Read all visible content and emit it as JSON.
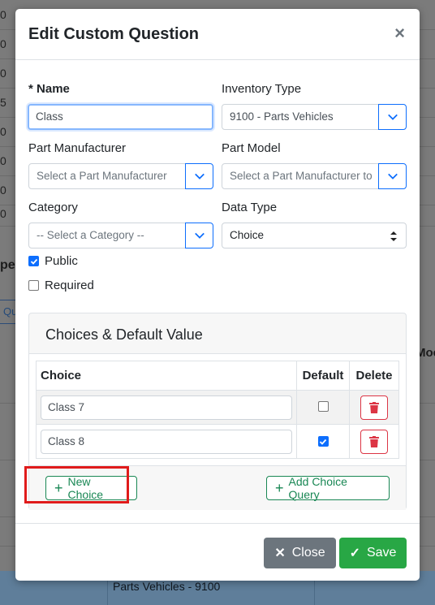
{
  "background": {
    "row_numbers": [
      "0",
      "0",
      "0",
      "5",
      "0",
      "0",
      "0",
      "0"
    ],
    "partial_heading": "pe",
    "partial_button": "Qu",
    "partial_right_heading": "Moc",
    "bottom_cell": "Parts Vehicles - 9100"
  },
  "modal": {
    "title": "Edit Custom Question",
    "close_glyph": "×",
    "fields": {
      "name": {
        "required_marker": "*",
        "label": "Name",
        "value": "Class"
      },
      "inventory_type": {
        "label": "Inventory Type",
        "value": "9100 - Parts Vehicles"
      },
      "part_manufacturer": {
        "label": "Part Manufacturer",
        "placeholder": "Select a Part Manufacturer"
      },
      "part_model": {
        "label": "Part Model",
        "placeholder": "Select a Part Manufacturer to"
      },
      "category": {
        "label": "Category",
        "placeholder": "-- Select a Category --"
      },
      "data_type": {
        "label": "Data Type",
        "value": "Choice"
      }
    },
    "checkboxes": {
      "public": {
        "label": "Public",
        "checked": true
      },
      "required": {
        "label": "Required",
        "checked": false
      }
    },
    "choices_card": {
      "title": "Choices & Default Value",
      "columns": [
        "Choice",
        "Default",
        "Delete"
      ],
      "rows": [
        {
          "choice": "Class 7",
          "default": false
        },
        {
          "choice": "Class 8",
          "default": true
        }
      ],
      "new_choice_label": "New Choice",
      "add_choice_query_label": "Add Choice Query"
    },
    "footer": {
      "close_label": "Close",
      "save_label": "Save"
    }
  },
  "colors": {
    "primary": "#0d6efd",
    "success": "#28a745",
    "danger": "#dc3545",
    "secondary": "#6c757d",
    "highlight": "#e01b1b"
  }
}
